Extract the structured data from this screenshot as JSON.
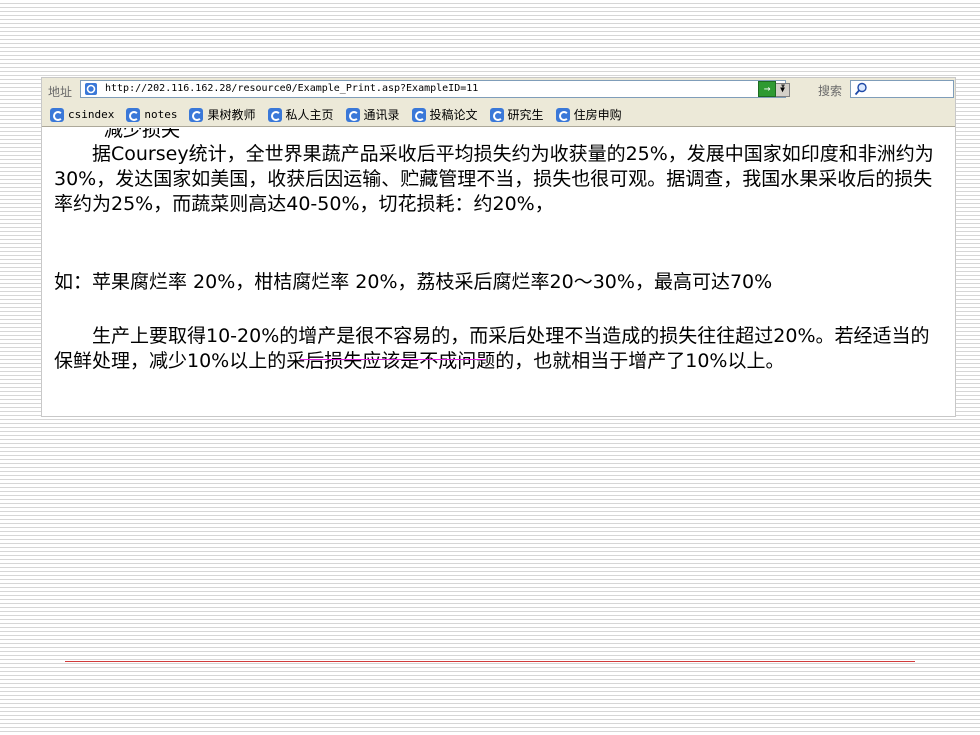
{
  "addressbar": {
    "label": "地址",
    "url": "http://202.116.162.28/resource0/Example_Print.asp?ExampleID=11",
    "search_label": "搜索"
  },
  "links": [
    {
      "label": "csindex"
    },
    {
      "label": "notes"
    },
    {
      "label": "果树教师"
    },
    {
      "label": "私人主页"
    },
    {
      "label": "通讯录"
    },
    {
      "label": "投稿论文"
    },
    {
      "label": "研究生"
    },
    {
      "label": "住房申购"
    }
  ],
  "content": {
    "cut_heading": "减少损失",
    "p1": "据Coursey统计，全世界果蔬产品采收后平均损失约为收获量的25%，发展中国家如印度和非洲约为30%，发达国家如美国，收获后因运输、贮藏管理不当，损失也很可观。据调查，我国水果采收后的损失率约为25%，而蔬菜则高达40-50%，切花损耗：约20%，",
    "p2": "如：苹果腐烂率 20%，柑桔腐烂率 20%，荔枝采后腐烂率20～30%，最高可达70%",
    "p3": "生产上要取得10-20%的增产是很不容易的，而采后处理不当造成的损失往往超过20%。若经适当的保鲜处理，减少10%以上的采后损失应该是不成问题的，也就相当于增产了10%以上。"
  }
}
